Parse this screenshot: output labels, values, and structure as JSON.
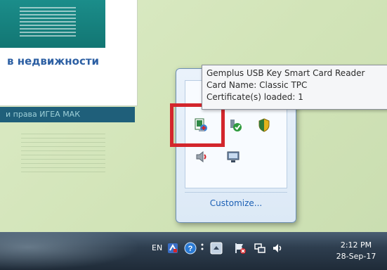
{
  "background_doc": {
    "heading": "в недвижности",
    "subtitle": "и права ИГЕА МАК"
  },
  "tooltip": {
    "line1": "Gemplus USB Key Smart Card Reader",
    "line2": "Card Name: Classic TPC",
    "line3": "Certificate(s) loaded: 1"
  },
  "tray_popup": {
    "customize_label": "Customize..."
  },
  "taskbar": {
    "language": "EN",
    "time": "2:12 PM",
    "date": "28-Sep-17"
  },
  "icons": {
    "smart_card_reader": "smart-card-reader-icon",
    "network_check": "network-check-icon",
    "security_shield": "security-shield-icon",
    "volume": "volume-icon",
    "display": "display-icon",
    "help": "help-icon",
    "action_center": "action-center-flag-icon"
  },
  "colors": {
    "highlight": "#d3262c",
    "link": "#1a5fb4"
  }
}
